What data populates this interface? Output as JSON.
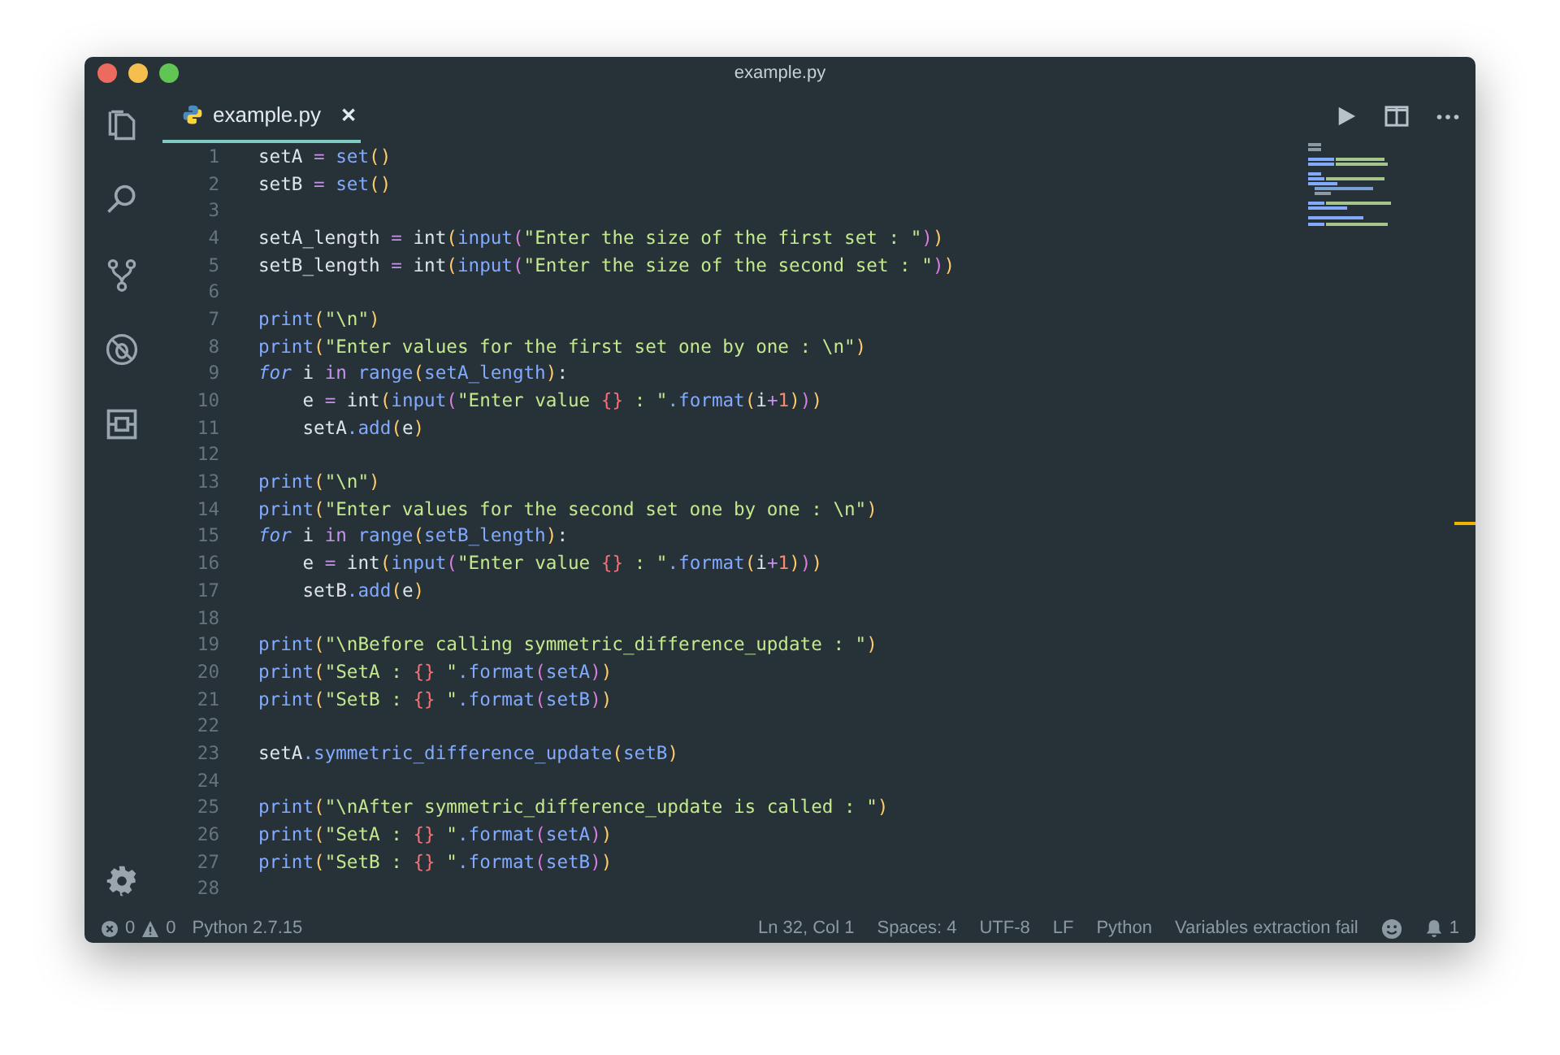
{
  "window": {
    "title": "example.py"
  },
  "tab": {
    "label": "example.py",
    "close": "✕",
    "selected": true
  },
  "code_lines": [
    {
      "number": "1",
      "tokens": [
        {
          "text": "setA ",
          "kind": "var"
        },
        {
          "text": "=",
          "kind": "op"
        },
        {
          "text": " set",
          "kind": "fn"
        },
        {
          "text": "()",
          "kind": "p1"
        }
      ]
    },
    {
      "number": "2",
      "tokens": [
        {
          "text": "setB ",
          "kind": "var"
        },
        {
          "text": "=",
          "kind": "op"
        },
        {
          "text": " set",
          "kind": "fn"
        },
        {
          "text": "()",
          "kind": "p1"
        }
      ]
    },
    {
      "number": "3"
    },
    {
      "number": "4",
      "tokens": [
        {
          "text": "setA_length ",
          "kind": "var"
        },
        {
          "text": "=",
          "kind": "op"
        },
        {
          "text": " int",
          "kind": "var"
        },
        {
          "text": "(",
          "kind": "p1"
        },
        {
          "text": "input",
          "kind": "fn"
        },
        {
          "text": "(",
          "kind": "p2"
        },
        {
          "text": "\"Enter the size of the first set : \"",
          "kind": "str"
        },
        {
          "text": ")",
          "kind": "p2"
        },
        {
          "text": ")",
          "kind": "p1"
        }
      ]
    },
    {
      "number": "5",
      "tokens": [
        {
          "text": "setB_length ",
          "kind": "var"
        },
        {
          "text": "=",
          "kind": "op"
        },
        {
          "text": " int",
          "kind": "var"
        },
        {
          "text": "(",
          "kind": "p1"
        },
        {
          "text": "input",
          "kind": "fn"
        },
        {
          "text": "(",
          "kind": "p2"
        },
        {
          "text": "\"Enter the size of the second set : \"",
          "kind": "str"
        },
        {
          "text": ")",
          "kind": "p2"
        },
        {
          "text": ")",
          "kind": "p1"
        }
      ]
    },
    {
      "number": "6"
    },
    {
      "number": "7",
      "tokens": [
        {
          "text": "print",
          "kind": "fn"
        },
        {
          "text": "(",
          "kind": "p1"
        },
        {
          "text": "\"\\n\"",
          "kind": "str"
        },
        {
          "text": ")",
          "kind": "p1"
        }
      ]
    },
    {
      "number": "8",
      "tokens": [
        {
          "text": "print",
          "kind": "fn"
        },
        {
          "text": "(",
          "kind": "p1"
        },
        {
          "text": "\"Enter values for the first set one by one : \\n\"",
          "kind": "str"
        },
        {
          "text": ")",
          "kind": "p1"
        }
      ]
    },
    {
      "number": "9",
      "tokens": [
        {
          "text": "for",
          "kind": "kw"
        },
        {
          "text": " i ",
          "kind": "var"
        },
        {
          "text": "in",
          "kind": "kw2"
        },
        {
          "text": " range",
          "kind": "fn"
        },
        {
          "text": "(",
          "kind": "p1"
        },
        {
          "text": "setA_length",
          "kind": "fn"
        },
        {
          "text": ")",
          "kind": "p1"
        },
        {
          "text": ":",
          "kind": "var"
        }
      ]
    },
    {
      "number": "10",
      "tokens": [
        {
          "text": "    e ",
          "kind": "var"
        },
        {
          "text": "=",
          "kind": "op"
        },
        {
          "text": " int",
          "kind": "var"
        },
        {
          "text": "(",
          "kind": "p1"
        },
        {
          "text": "input",
          "kind": "fn"
        },
        {
          "text": "(",
          "kind": "p2"
        },
        {
          "text": "\"Enter value ",
          "kind": "str"
        },
        {
          "text": "{}",
          "kind": "brace"
        },
        {
          "text": " : \"",
          "kind": "str"
        },
        {
          "text": ".format",
          "kind": "fn"
        },
        {
          "text": "(",
          "kind": "p1"
        },
        {
          "text": "i",
          "kind": "var"
        },
        {
          "text": "+",
          "kind": "op"
        },
        {
          "text": "1",
          "kind": "num"
        },
        {
          "text": ")",
          "kind": "p1"
        },
        {
          "text": ")",
          "kind": "p2"
        },
        {
          "text": ")",
          "kind": "p1"
        }
      ]
    },
    {
      "number": "11",
      "tokens": [
        {
          "text": "    setA",
          "kind": "var"
        },
        {
          "text": ".add",
          "kind": "fn"
        },
        {
          "text": "(",
          "kind": "p1"
        },
        {
          "text": "e",
          "kind": "var"
        },
        {
          "text": ")",
          "kind": "p1"
        }
      ]
    },
    {
      "number": "12"
    },
    {
      "number": "13",
      "tokens": [
        {
          "text": "print",
          "kind": "fn"
        },
        {
          "text": "(",
          "kind": "p1"
        },
        {
          "text": "\"\\n\"",
          "kind": "str"
        },
        {
          "text": ")",
          "kind": "p1"
        }
      ]
    },
    {
      "number": "14",
      "tokens": [
        {
          "text": "print",
          "kind": "fn"
        },
        {
          "text": "(",
          "kind": "p1"
        },
        {
          "text": "\"Enter values for the second set one by one : \\n\"",
          "kind": "str"
        },
        {
          "text": ")",
          "kind": "p1"
        }
      ]
    },
    {
      "number": "15",
      "tokens": [
        {
          "text": "for",
          "kind": "kw"
        },
        {
          "text": " i ",
          "kind": "var"
        },
        {
          "text": "in",
          "kind": "kw2"
        },
        {
          "text": " range",
          "kind": "fn"
        },
        {
          "text": "(",
          "kind": "p1"
        },
        {
          "text": "setB_length",
          "kind": "fn"
        },
        {
          "text": ")",
          "kind": "p1"
        },
        {
          "text": ":",
          "kind": "var"
        }
      ]
    },
    {
      "number": "16",
      "tokens": [
        {
          "text": "    e ",
          "kind": "var"
        },
        {
          "text": "=",
          "kind": "op"
        },
        {
          "text": " int",
          "kind": "var"
        },
        {
          "text": "(",
          "kind": "p1"
        },
        {
          "text": "input",
          "kind": "fn"
        },
        {
          "text": "(",
          "kind": "p2"
        },
        {
          "text": "\"Enter value ",
          "kind": "str"
        },
        {
          "text": "{}",
          "kind": "brace"
        },
        {
          "text": " : \"",
          "kind": "str"
        },
        {
          "text": ".format",
          "kind": "fn"
        },
        {
          "text": "(",
          "kind": "p1"
        },
        {
          "text": "i",
          "kind": "var"
        },
        {
          "text": "+",
          "kind": "op"
        },
        {
          "text": "1",
          "kind": "num"
        },
        {
          "text": ")",
          "kind": "p1"
        },
        {
          "text": ")",
          "kind": "p2"
        },
        {
          "text": ")",
          "kind": "p1"
        }
      ]
    },
    {
      "number": "17",
      "tokens": [
        {
          "text": "    setB",
          "kind": "var"
        },
        {
          "text": ".add",
          "kind": "fn"
        },
        {
          "text": "(",
          "kind": "p1"
        },
        {
          "text": "e",
          "kind": "var"
        },
        {
          "text": ")",
          "kind": "p1"
        }
      ]
    },
    {
      "number": "18"
    },
    {
      "number": "19",
      "tokens": [
        {
          "text": "print",
          "kind": "fn"
        },
        {
          "text": "(",
          "kind": "p1"
        },
        {
          "text": "\"\\nBefore calling symmetric_difference_update : \"",
          "kind": "str"
        },
        {
          "text": ")",
          "kind": "p1"
        }
      ]
    },
    {
      "number": "20",
      "tokens": [
        {
          "text": "print",
          "kind": "fn"
        },
        {
          "text": "(",
          "kind": "p1"
        },
        {
          "text": "\"SetA : ",
          "kind": "str"
        },
        {
          "text": "{}",
          "kind": "brace"
        },
        {
          "text": " \"",
          "kind": "str"
        },
        {
          "text": ".format",
          "kind": "fn"
        },
        {
          "text": "(",
          "kind": "p2"
        },
        {
          "text": "setA",
          "kind": "fn"
        },
        {
          "text": ")",
          "kind": "p2"
        },
        {
          "text": ")",
          "kind": "p1"
        }
      ]
    },
    {
      "number": "21",
      "tokens": [
        {
          "text": "print",
          "kind": "fn"
        },
        {
          "text": "(",
          "kind": "p1"
        },
        {
          "text": "\"SetB : ",
          "kind": "str"
        },
        {
          "text": "{}",
          "kind": "brace"
        },
        {
          "text": " \"",
          "kind": "str"
        },
        {
          "text": ".format",
          "kind": "fn"
        },
        {
          "text": "(",
          "kind": "p2"
        },
        {
          "text": "setB",
          "kind": "fn"
        },
        {
          "text": ")",
          "kind": "p2"
        },
        {
          "text": ")",
          "kind": "p1"
        }
      ]
    },
    {
      "number": "22"
    },
    {
      "number": "23",
      "tokens": [
        {
          "text": "setA",
          "kind": "var"
        },
        {
          "text": ".symmetric_difference_update",
          "kind": "fn"
        },
        {
          "text": "(",
          "kind": "p1"
        },
        {
          "text": "setB",
          "kind": "fn"
        },
        {
          "text": ")",
          "kind": "p1"
        }
      ]
    },
    {
      "number": "24"
    },
    {
      "number": "25",
      "tokens": [
        {
          "text": "print",
          "kind": "fn"
        },
        {
          "text": "(",
          "kind": "p1"
        },
        {
          "text": "\"\\nAfter symmetric_difference_update is called : \"",
          "kind": "str"
        },
        {
          "text": ")",
          "kind": "p1"
        }
      ]
    },
    {
      "number": "26",
      "tokens": [
        {
          "text": "print",
          "kind": "fn"
        },
        {
          "text": "(",
          "kind": "p1"
        },
        {
          "text": "\"SetA : ",
          "kind": "str"
        },
        {
          "text": "{}",
          "kind": "brace"
        },
        {
          "text": " \"",
          "kind": "str"
        },
        {
          "text": ".format",
          "kind": "fn"
        },
        {
          "text": "(",
          "kind": "p2"
        },
        {
          "text": "setA",
          "kind": "fn"
        },
        {
          "text": ")",
          "kind": "p2"
        },
        {
          "text": ")",
          "kind": "p1"
        }
      ]
    },
    {
      "number": "27",
      "tokens": [
        {
          "text": "print",
          "kind": "fn"
        },
        {
          "text": "(",
          "kind": "p1"
        },
        {
          "text": "\"SetB : ",
          "kind": "str"
        },
        {
          "text": "{}",
          "kind": "brace"
        },
        {
          "text": " \"",
          "kind": "str"
        },
        {
          "text": ".format",
          "kind": "fn"
        },
        {
          "text": "(",
          "kind": "p2"
        },
        {
          "text": "setB",
          "kind": "fn"
        },
        {
          "text": ")",
          "kind": "p2"
        },
        {
          "text": ")",
          "kind": "p1"
        }
      ]
    },
    {
      "number": "28"
    }
  ],
  "status_bar": {
    "errors": "0",
    "warnings": "0",
    "interpreter": "Python 2.7.15",
    "right_items": [
      "Ln 32, Col 1",
      "Spaces: 4",
      "UTF-8",
      "LF",
      "Python",
      "Variables extraction fail"
    ],
    "notifications": "1"
  }
}
